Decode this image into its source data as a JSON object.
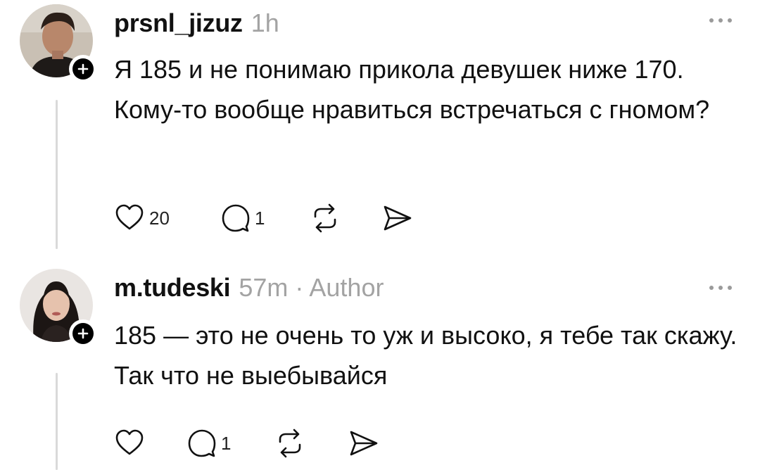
{
  "posts": [
    {
      "username": "prsnl_jizuz",
      "time": "1h",
      "author_badge": "",
      "text": "Я 185 и не понимаю прикола девушек ниже 170. Кому-то вообще нравиться встречаться с гномом?",
      "likes": "20",
      "replies": "1"
    },
    {
      "username": "m.tudeski",
      "time": "57m",
      "author_badge": "· Author",
      "text": "185 — это не очень то уж и высоко, я тебе так скажу. Так что не выебывайся",
      "likes": "",
      "replies": "1"
    }
  ],
  "icons": {
    "like": "heart-icon",
    "reply": "comment-icon",
    "repost": "repost-icon",
    "share": "send-icon",
    "more": "more-icon",
    "follow": "plus-icon"
  },
  "colors": {
    "text": "#111111",
    "meta": "#a3a3a3",
    "thread_line": "#d9d9d9",
    "follow_badge": "#000000"
  }
}
